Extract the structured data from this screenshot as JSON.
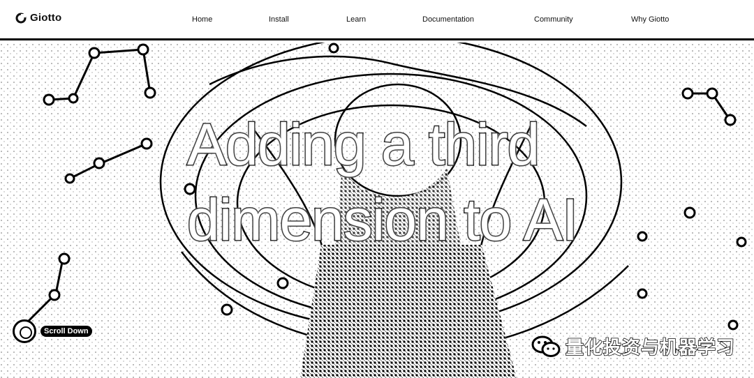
{
  "brand": {
    "name": "Giotto"
  },
  "nav": {
    "items": [
      {
        "label": "Home"
      },
      {
        "label": "Install"
      },
      {
        "label": "Learn"
      },
      {
        "label": "Documentation"
      },
      {
        "label": "Community"
      },
      {
        "label": "Why Giotto"
      }
    ]
  },
  "hero": {
    "headline_line1": "Adding a third",
    "headline_line2": "dimension to AI",
    "scroll_label": "Scroll Down"
  },
  "watermark": {
    "text": "量化投资与机器学习"
  },
  "colors": {
    "text": "#000000",
    "background": "#ffffff",
    "accent": "#000000"
  }
}
